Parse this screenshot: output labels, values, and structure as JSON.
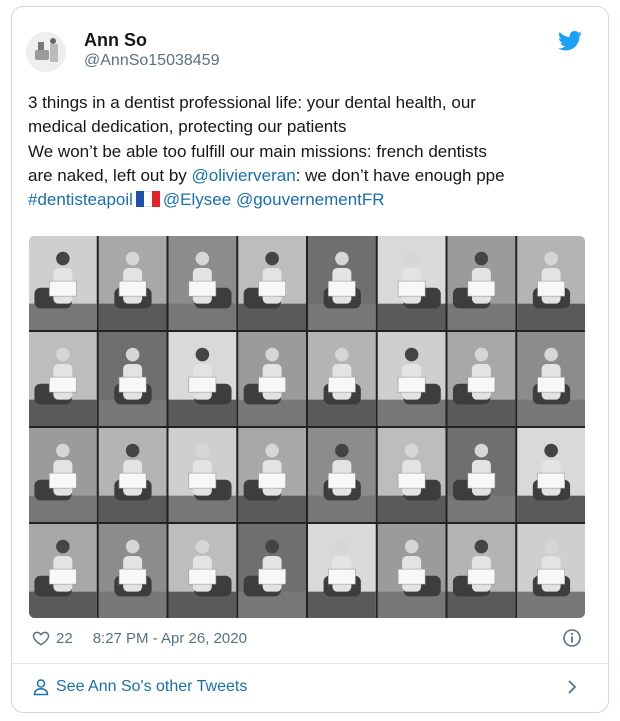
{
  "user": {
    "name": "Ann So",
    "handle": "@AnnSo15038459"
  },
  "tweet": {
    "line1": "3 things in a dentist professional life: your dental health, our",
    "line2": "medical dedication, protecting our patients",
    "line3": "We won’t be able too fulfill our main missions: french dentists",
    "line4_pre": "are naked, left out by ",
    "mention_olivier": "@olivierveran",
    "line4_post": ": we don’t have enough ppe",
    "hashtag": "#dentisteapoil",
    "mention_elysee": "@Elysee",
    "mention_gouv": "@gouvernementFR"
  },
  "meta": {
    "like_count": "22",
    "timestamp": "8:27 PM - Apr 26, 2020"
  },
  "footer": {
    "see_more": "See Ann So's other Tweets"
  },
  "colors": {
    "link": "#1b6fa8",
    "twitter_blue": "#1da1f2",
    "muted": "#5b7083"
  },
  "icons": [
    "twitter-bird-icon",
    "heart-icon",
    "info-icon",
    "person-icon",
    "chevron-right-icon",
    "france-flag-emoji"
  ]
}
